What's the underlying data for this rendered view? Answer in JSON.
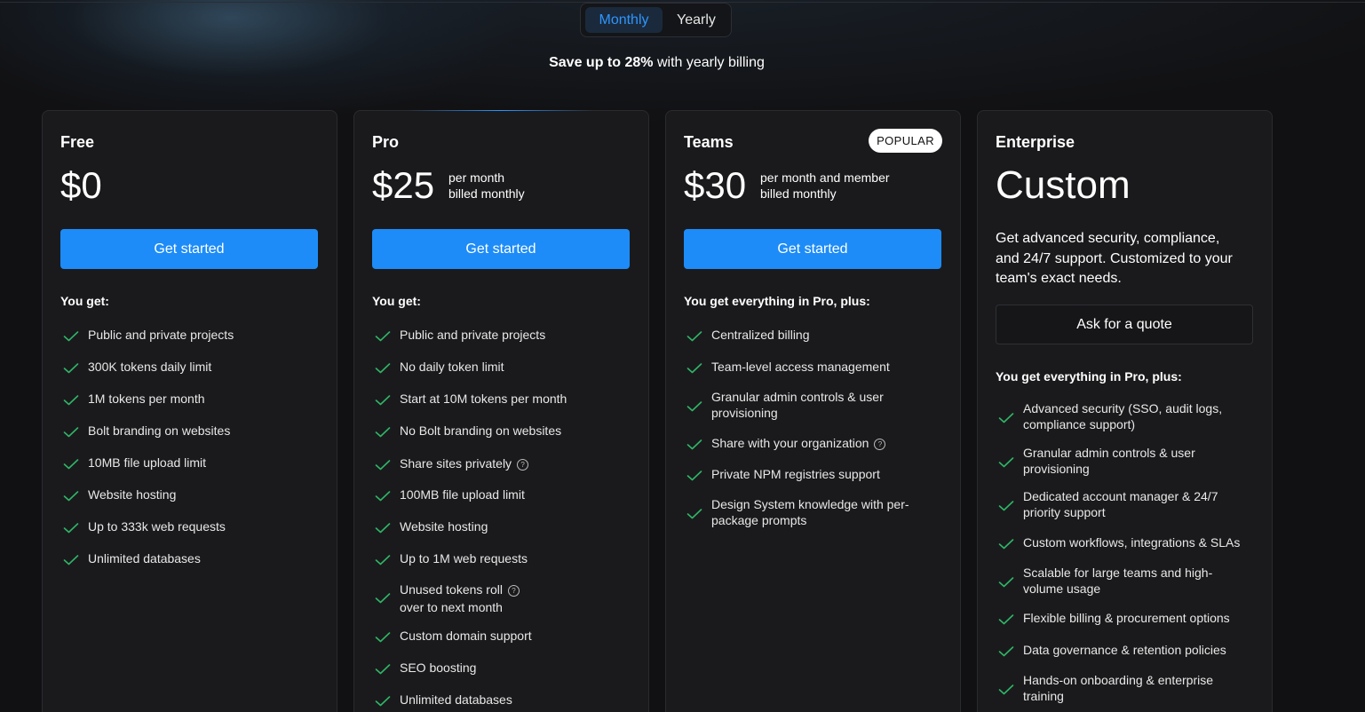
{
  "billing_toggle": {
    "monthly_label": "Monthly",
    "yearly_label": "Yearly",
    "selected": "Monthly"
  },
  "save_note": {
    "prefix": "Save up to",
    "percent": "28%",
    "suffix": "with yearly billing"
  },
  "colors": {
    "accent": "#1d8cf8",
    "check": "#2fb567",
    "card_bg": "#1a1a1c",
    "page_bg": "#111113"
  },
  "plans": [
    {
      "name": "Free",
      "price": "$0",
      "price_note_1": "",
      "price_note_2": "",
      "cta_label": "Get started",
      "features_title": "You get:",
      "features": [
        "Public and private projects",
        "300K tokens daily limit",
        "1M tokens per month",
        "Bolt branding on websites",
        "10MB file upload limit",
        "Website hosting",
        "Up to 333k web requests",
        "Unlimited databases"
      ]
    },
    {
      "name": "Pro",
      "price": "$25",
      "price_note_1": "per month",
      "price_note_2": "billed monthly",
      "cta_label": "Get started",
      "features_title": "You get:",
      "features": [
        "Public and private projects",
        "No daily token limit",
        "Start at 10M tokens per month",
        "No Bolt branding on websites",
        "Share sites privately",
        "100MB file upload limit",
        "Website hosting",
        "Up to 1M web requests",
        "Unused tokens roll",
        "over to next month",
        "Custom domain support",
        "SEO boosting",
        "Unlimited databases"
      ]
    },
    {
      "name": "Teams",
      "badge": "POPULAR",
      "price": "$30",
      "price_note_1": "per month and member",
      "price_note_2": "billed monthly",
      "cta_label": "Get started",
      "features_title": "You get everything in Pro, plus:",
      "features": [
        "Centralized billing",
        "Team-level access management",
        "Granular admin controls & user",
        "provisioning",
        "Share with your organization",
        "Private NPM registries support",
        "Design System knowledge with per-",
        "package prompts"
      ]
    },
    {
      "name": "Enterprise",
      "price": "Custom",
      "description_lines": [
        "Get advanced security, compliance,",
        "and 24/7 support. Customized to your",
        "team's exact needs."
      ],
      "cta_label": "Ask for a quote",
      "features_title": "You get everything in Pro, plus:",
      "features": [
        "Advanced security (SSO, audit logs,",
        "compliance support)",
        "Granular admin controls & user",
        "provisioning",
        "Dedicated account manager & 24/7",
        "priority support",
        "Custom workflows, integrations & SLAs",
        "Scalable for large teams and high-",
        "volume usage",
        "Flexible billing & procurement options",
        "Data governance & retention policies",
        "Hands-on onboarding & enterprise",
        "training"
      ]
    }
  ],
  "icons": {
    "check": "check-icon",
    "help": "question-circle-icon"
  },
  "help_glyph": "?"
}
